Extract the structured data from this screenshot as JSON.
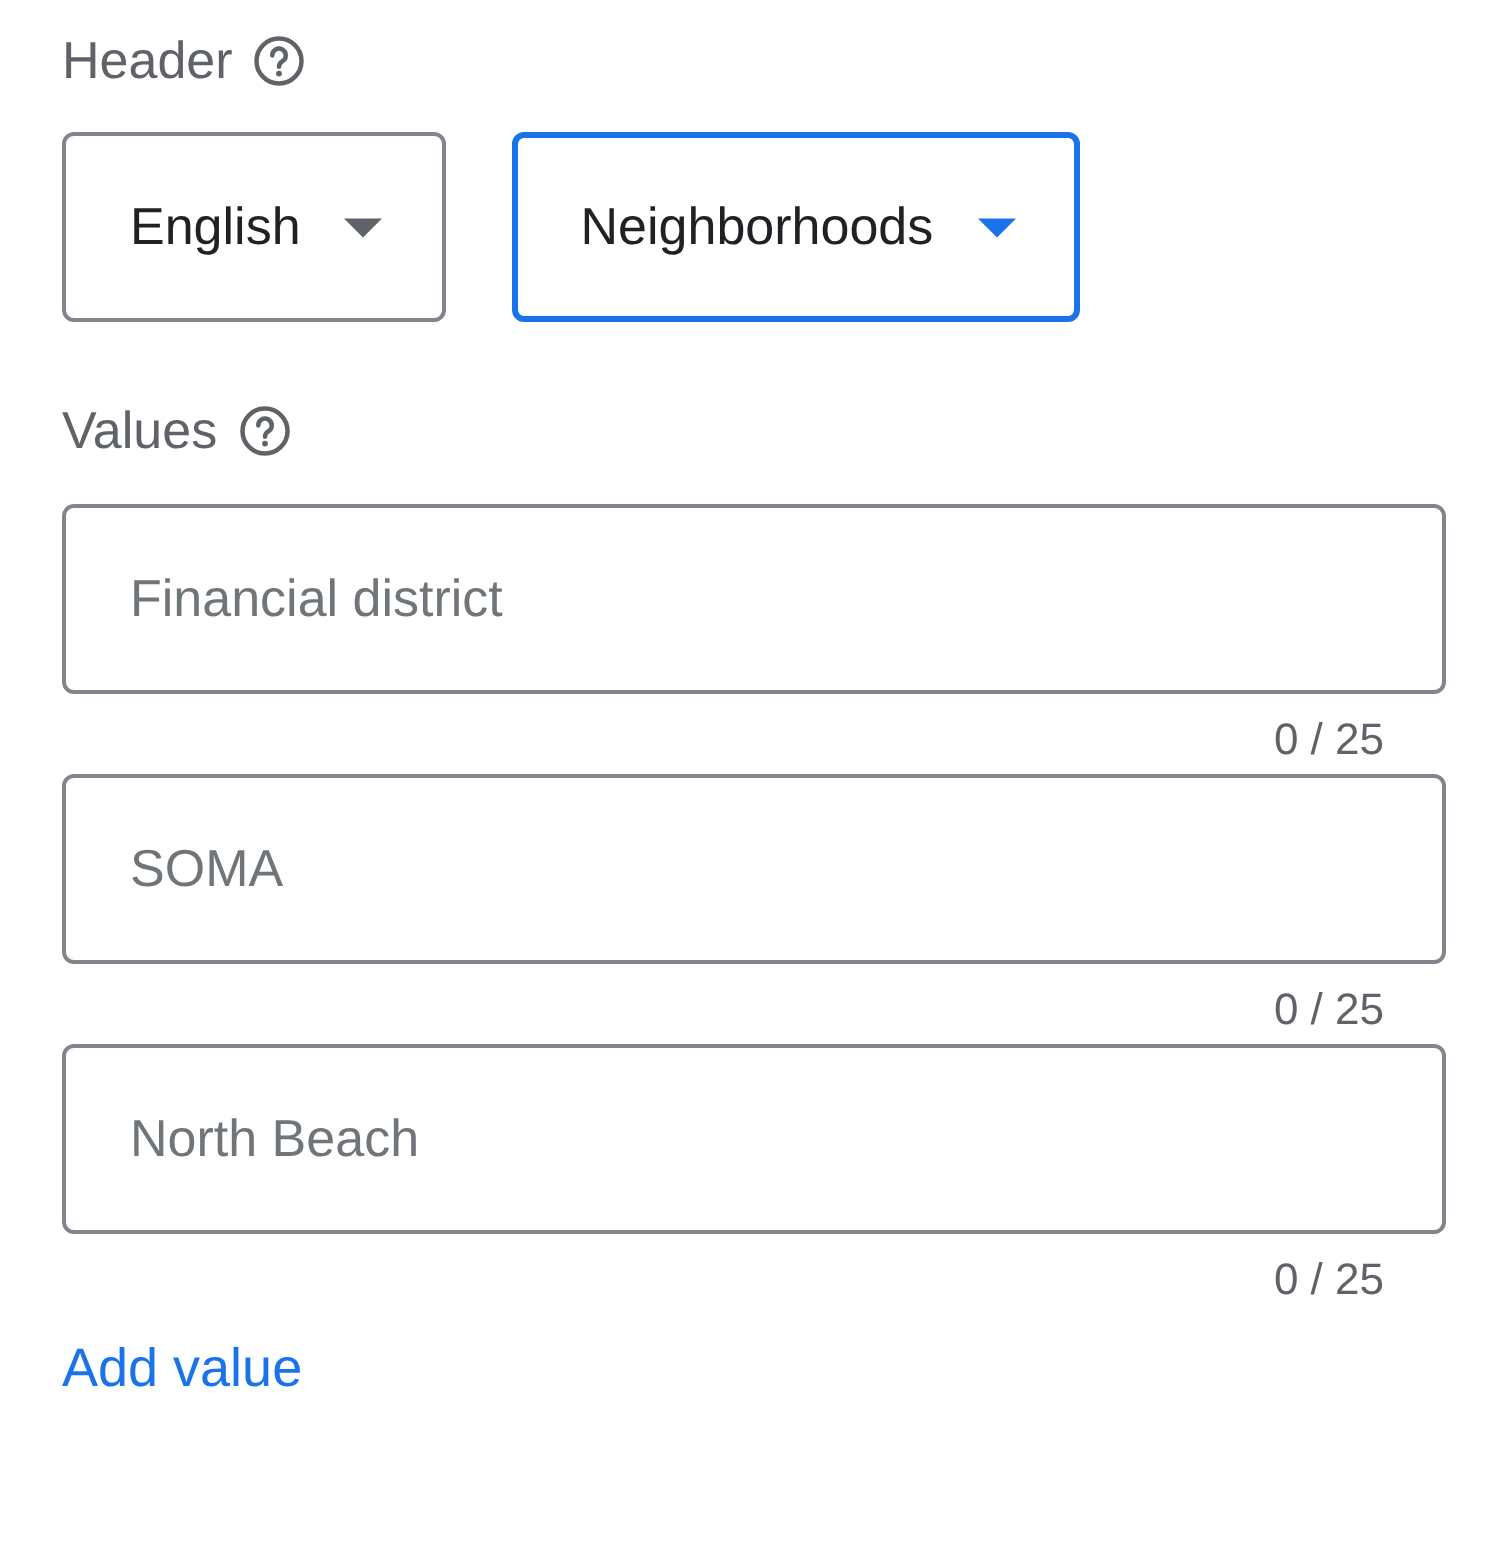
{
  "header": {
    "label": "Header",
    "dropdowns": [
      {
        "value": "English",
        "focused": false
      },
      {
        "value": "Neighborhoods",
        "focused": true
      }
    ]
  },
  "values": {
    "label": "Values",
    "fields": [
      {
        "placeholder": "Financial district",
        "counter": "0 / 25"
      },
      {
        "placeholder": "SOMA",
        "counter": "0 / 25"
      },
      {
        "placeholder": "North Beach",
        "counter": "0 / 25"
      }
    ],
    "add_link": "Add value"
  }
}
